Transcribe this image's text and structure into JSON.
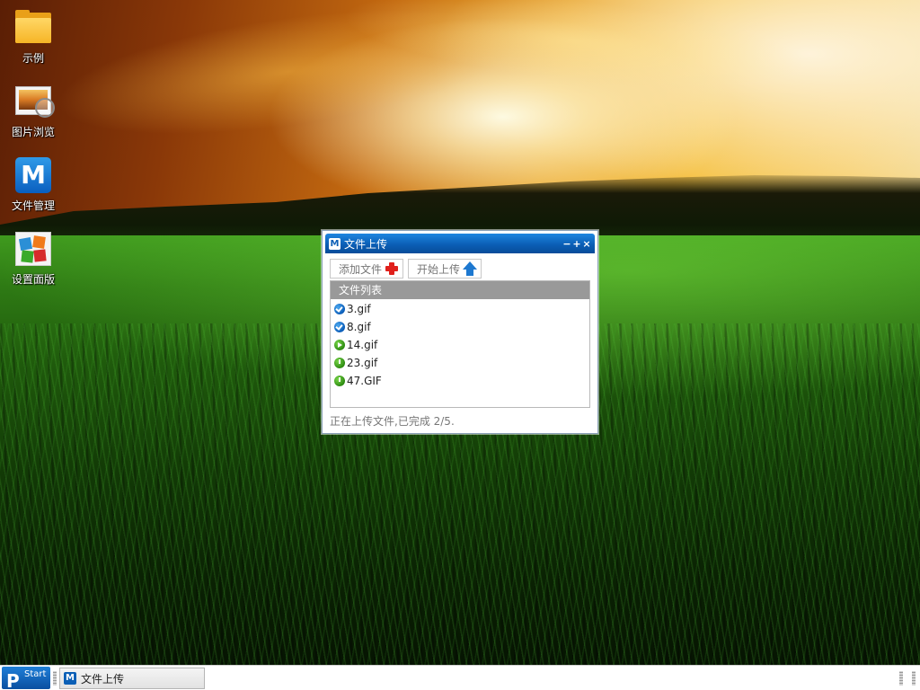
{
  "desktop": {
    "icons": [
      {
        "label": "示例",
        "icon": "folder-icon"
      },
      {
        "label": "图片浏览",
        "icon": "image-viewer-icon"
      },
      {
        "label": "文件管理",
        "icon": "file-manager-icon",
        "glyph": "M"
      },
      {
        "label": "设置面版",
        "icon": "settings-panel-icon"
      }
    ]
  },
  "upload_window": {
    "title": "文件上传",
    "app_icon_glyph": "M",
    "controls": {
      "minimize": "−",
      "maximize": "+",
      "close": "×"
    },
    "toolbar": {
      "add_label": "添加文件",
      "add_icon": "red-plus-icon",
      "start_label": "开始上传",
      "start_icon": "blue-up-arrow-icon"
    },
    "file_list": {
      "header": "文件列表",
      "items": [
        {
          "name": "3.gif",
          "state": "done",
          "icon": "check-icon"
        },
        {
          "name": "8.gif",
          "state": "done",
          "icon": "check-icon"
        },
        {
          "name": "14.gif",
          "state": "uploading",
          "icon": "play-icon"
        },
        {
          "name": "23.gif",
          "state": "waiting",
          "icon": "pending-icon"
        },
        {
          "name": "47.GIF",
          "state": "waiting",
          "icon": "pending-icon"
        }
      ]
    },
    "status": "正在上传文件,已完成 2/5."
  },
  "taskbar": {
    "start_label": "Start",
    "start_glyph": "P",
    "tasks": [
      {
        "label": "文件上传",
        "glyph": "M"
      }
    ]
  },
  "colors": {
    "titlebar": "#0b5fb6",
    "list_header": "#999999",
    "done_icon": "#0a5cb8",
    "pending_icon": "#2c8a10",
    "add_icon": "#e0201c",
    "upload_icon": "#1d78d0"
  }
}
